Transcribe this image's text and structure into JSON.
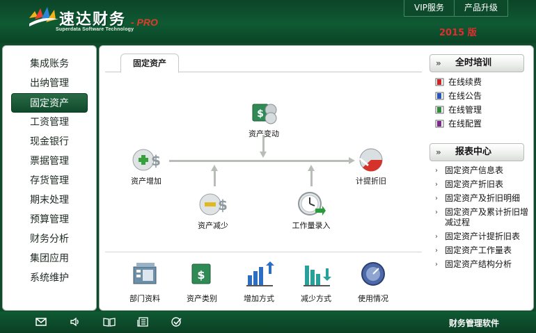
{
  "header": {
    "logo_text": "速达财务",
    "logo_pro": "- PRO",
    "logo_sub": "Superdata Software Technology",
    "links": [
      "VIP服务",
      "产品升级"
    ],
    "version": "2015 版"
  },
  "sidebar": {
    "items": [
      {
        "label": "集成账务"
      },
      {
        "label": "出纳管理"
      },
      {
        "label": "固定资产",
        "active": true
      },
      {
        "label": "工资管理"
      },
      {
        "label": "现金银行"
      },
      {
        "label": "票据管理"
      },
      {
        "label": "存货管理"
      },
      {
        "label": "期末处理"
      },
      {
        "label": "预算管理"
      },
      {
        "label": "财务分析"
      },
      {
        "label": "集团应用"
      },
      {
        "label": "系统维护"
      }
    ]
  },
  "main": {
    "tab": "固定资产",
    "flow": {
      "change": "资产变动",
      "add": "资产增加",
      "depreciation": "计提折旧",
      "reduce": "资产减少",
      "workload": "工作量录入"
    },
    "tools": [
      "部门资料",
      "资产类别",
      "增加方式",
      "减少方式",
      "使用情况"
    ]
  },
  "right": {
    "training": {
      "title": "全时培训",
      "items": [
        "在线续费",
        "在线公告",
        "在线管理",
        "在线配置"
      ]
    },
    "reports": {
      "title": "报表中心",
      "items": [
        "固定资产信息表",
        "固定资产折旧表",
        "固定资产及折旧明细",
        "固定资产及累计折旧增减过程",
        "固定资产计提折旧表",
        "固定资产工作量表",
        "固定资产结构分析"
      ]
    }
  },
  "footer": {
    "icons": [
      "mail-icon",
      "speaker-icon",
      "book-icon",
      "news-icon",
      "check-icon"
    ],
    "text": "财务管理软件"
  },
  "colors": {
    "header_green": "#0f5a33",
    "active_green": "#0f4a2c",
    "version_red": "#e12d2d",
    "pro_red": "#e03a2b"
  }
}
